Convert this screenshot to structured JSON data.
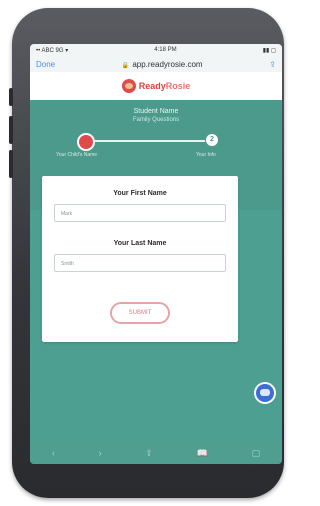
{
  "status_bar": {
    "carrier": "•• ABC 9G ▾",
    "time": "4:18 PM",
    "battery": "▮▮ ◻"
  },
  "browser": {
    "done_label": "Done",
    "url": "app.readyrosie.com",
    "lock_icon": "lock-icon",
    "share_icon": "share-icon"
  },
  "brand": {
    "name_part1": "Ready",
    "name_part2": "Rosie"
  },
  "hero": {
    "title": "Student Name",
    "subtitle": "Family Questions",
    "step1_label": "Your Child's Name",
    "step2_number": "2",
    "step2_label": "Your Info"
  },
  "form": {
    "first_name_label": "Your First Name",
    "first_name_placeholder": "Mark",
    "last_name_label": "Your Last Name",
    "last_name_placeholder": "Smith",
    "submit_label": "SUBMIT"
  },
  "bottom_bar": {
    "icons": [
      "back-icon",
      "forward-icon",
      "share-icon",
      "bookmarks-icon",
      "tabs-icon"
    ],
    "glyphs": [
      "‹",
      "›",
      "⇪",
      "📖",
      "▢"
    ]
  },
  "colors": {
    "teal": "#4b9a8c",
    "red": "#e04a4a",
    "link_blue": "#4a8ff0"
  }
}
